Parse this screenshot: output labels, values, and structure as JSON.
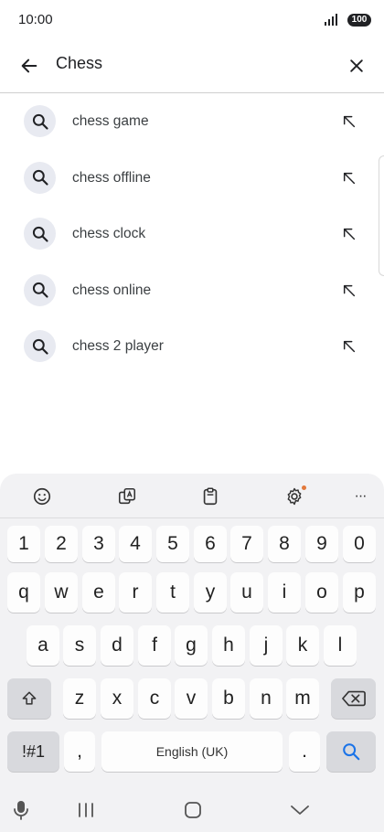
{
  "status_bar": {
    "time": "10:00",
    "battery": "100"
  },
  "search": {
    "query": "Chess"
  },
  "suggestions": [
    {
      "label": "chess game"
    },
    {
      "label": "chess offline"
    },
    {
      "label": "chess clock"
    },
    {
      "label": "chess online"
    },
    {
      "label": "chess 2 player"
    }
  ],
  "keyboard": {
    "number_row": [
      "1",
      "2",
      "3",
      "4",
      "5",
      "6",
      "7",
      "8",
      "9",
      "0"
    ],
    "row1": [
      "q",
      "w",
      "e",
      "r",
      "t",
      "y",
      "u",
      "i",
      "o",
      "p"
    ],
    "row2": [
      "a",
      "s",
      "d",
      "f",
      "g",
      "h",
      "j",
      "k",
      "l"
    ],
    "row3": [
      "z",
      "x",
      "c",
      "v",
      "b",
      "n",
      "m"
    ],
    "symbols_key": "!#1",
    "comma_key": ",",
    "space_label": "English (UK)",
    "period_key": ".",
    "more_label": "···"
  },
  "colors": {
    "accent": "#1a73e8",
    "icon_bg": "#e8eaf1",
    "badge": "#e2783b"
  }
}
